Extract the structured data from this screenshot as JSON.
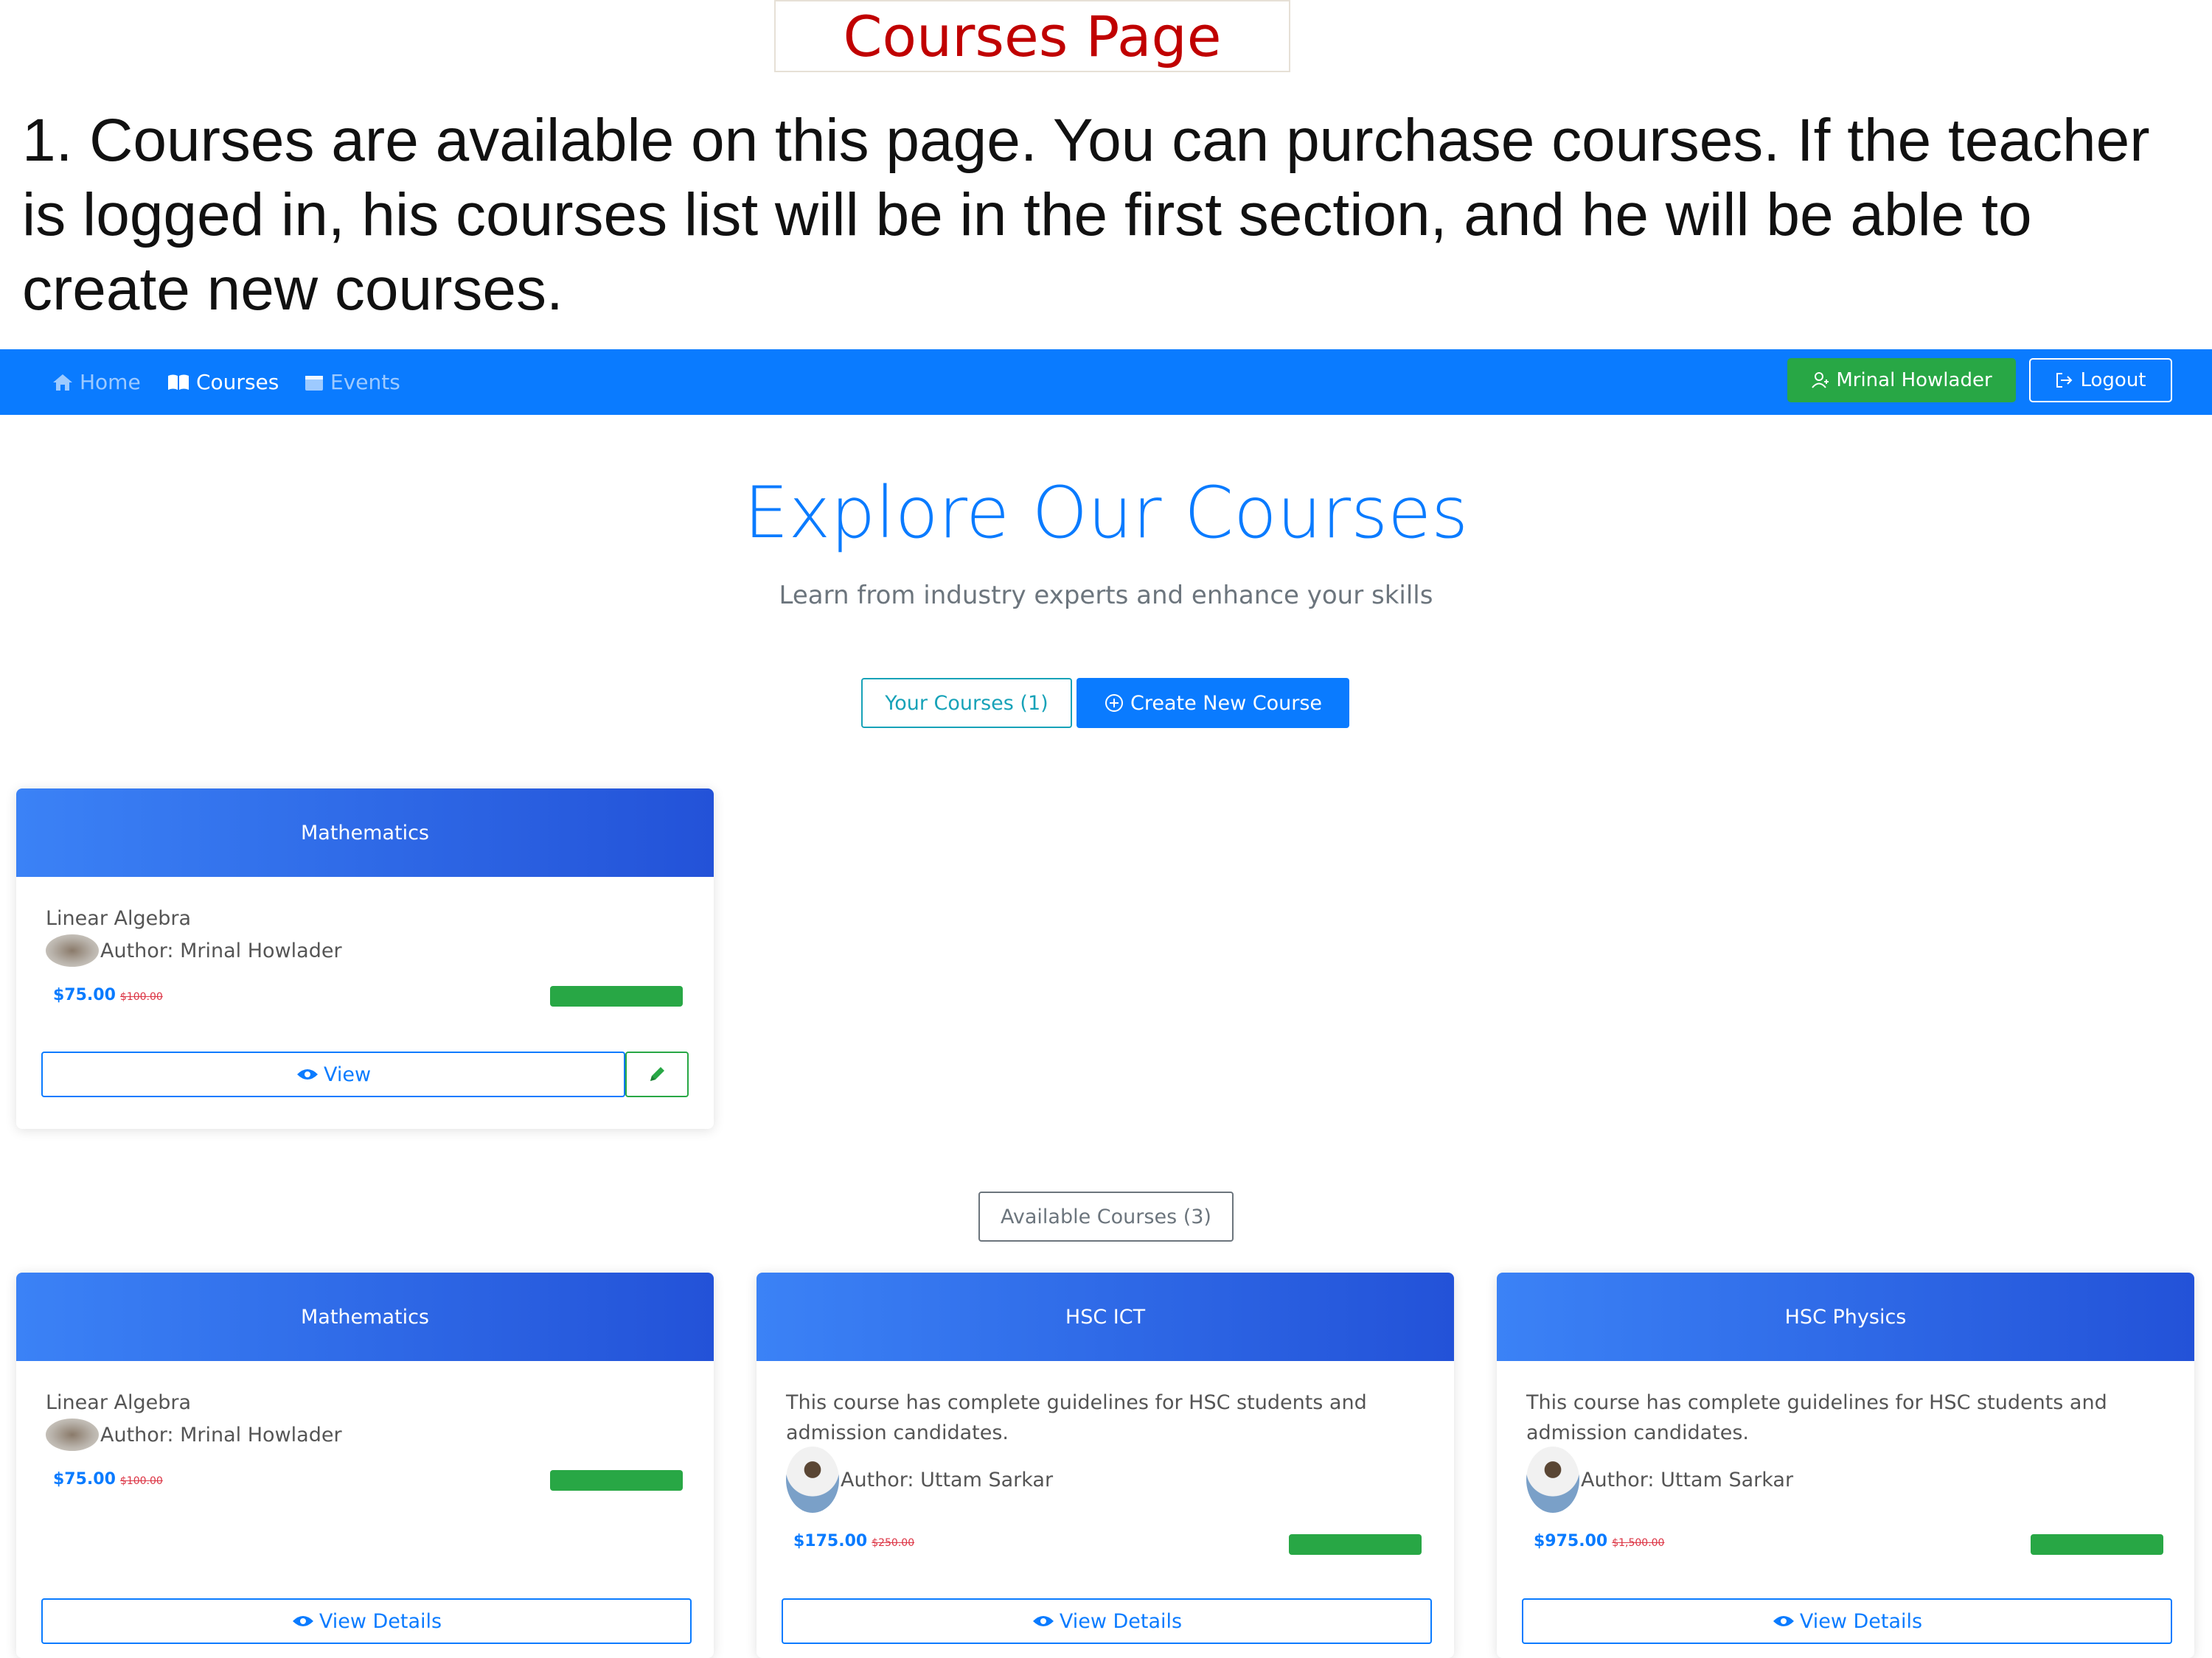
{
  "doc": {
    "title": "Courses Page",
    "description": "1. Courses are available on this page. You can purchase courses. If the teacher is logged in, his courses list will be in the first section, and he will be able to create new courses."
  },
  "navbar": {
    "items": [
      {
        "label": "Home",
        "icon": "home-icon",
        "active": false
      },
      {
        "label": "Courses",
        "icon": "book-icon",
        "active": true
      },
      {
        "label": "Events",
        "icon": "calendar-icon",
        "active": false
      }
    ],
    "user_label": "Mrinal Howlader",
    "logout_label": "Logout"
  },
  "hero": {
    "title": "Explore Our Courses",
    "subtitle": "Learn from industry experts and enhance your skills",
    "your_courses_label": "Your Courses (1)",
    "create_label": "Create New Course",
    "available_label": "Available Courses (3)"
  },
  "your_courses": [
    {
      "header": "Mathematics",
      "description": "Linear Algebra",
      "author": "Author: Mrinal Howlader",
      "price": "$75.00",
      "old_price": "$100.00",
      "button": "View"
    }
  ],
  "available_courses": [
    {
      "header": "Mathematics",
      "description": "Linear Algebra",
      "author": "Author: Mrinal Howlader",
      "price": "$75.00",
      "old_price": "$100.00",
      "button": "View Details"
    },
    {
      "header": "HSC ICT",
      "description": "This course has complete guidelines for HSC students and admission candidates.",
      "author": "Author: Uttam Sarkar",
      "price": "$175.00",
      "old_price": "$250.00",
      "button": "View Details"
    },
    {
      "header": "HSC Physics",
      "description": "This course has complete guidelines for HSC students and admission candidates.",
      "author": "Author: Uttam Sarkar",
      "price": "$975.00",
      "old_price": "$1,500.00",
      "button": "View Details"
    }
  ],
  "colors": {
    "primary": "#0a7bff",
    "success": "#28a745",
    "info": "#17a2b8",
    "danger": "#dc3545",
    "annotation_title": "#c00000"
  }
}
